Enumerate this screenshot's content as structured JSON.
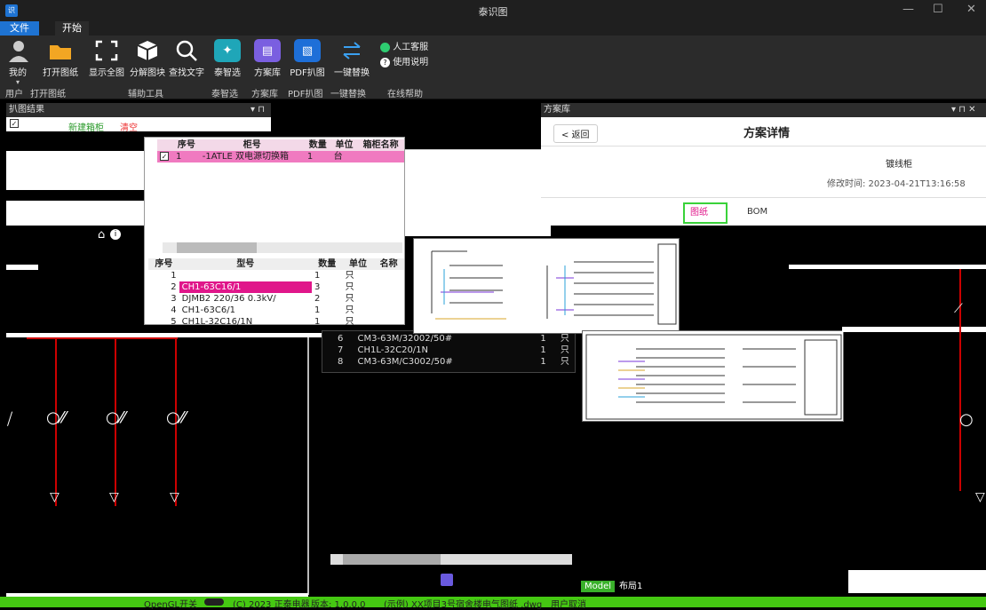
{
  "window": {
    "title": "泰识图",
    "min": "—",
    "max": "☐",
    "close": "✕"
  },
  "menu": {
    "file": "文件",
    "start": "开始"
  },
  "ribbon": {
    "buttons": {
      "me": "我的",
      "open": "打开图纸",
      "show_all": "显示全图",
      "explode": "分解图块",
      "find_text": "查找文字",
      "smart": "泰智选",
      "scheme_lib": "方案库",
      "pdf": "PDF扒图",
      "replace": "一键替换",
      "human": "人工客服",
      "help": "使用说明"
    },
    "groups": {
      "user": "用户",
      "open": "打开图纸",
      "aux": "辅助工具",
      "smart": "泰智选",
      "scheme_lib": "方案库",
      "pdf": "PDF扒图",
      "replace": "一键替换",
      "online": "在线帮助"
    }
  },
  "left_panel": {
    "title": "扒图结果",
    "pin": "▾ ⊓",
    "new_cabinet": "新建箱柜",
    "clear": "清空"
  },
  "cabinet_table": {
    "headers": [
      "序号",
      "柜号",
      "数量",
      "单位",
      "箱柜名称"
    ],
    "row": {
      "no": "1",
      "name": "-1ATLE 双电源切换箱",
      "qty": "1",
      "unit": "台"
    }
  },
  "parts_table": {
    "headers": [
      "序号",
      "型号",
      "数量",
      "单位",
      "名称"
    ],
    "rows": [
      {
        "no": "1",
        "model": "",
        "qty": "1",
        "unit": "只"
      },
      {
        "no": "2",
        "model": "CH1-63C16/1",
        "qty": "3",
        "unit": "只"
      },
      {
        "no": "3",
        "model": "DJMB2 220/36 0.3kV/",
        "qty": "2",
        "unit": "只"
      },
      {
        "no": "4",
        "model": "CH1-63C6/1",
        "qty": "1",
        "unit": "只"
      },
      {
        "no": "5",
        "model": "CH1L-32C16/1N",
        "qty": "1",
        "unit": "只"
      }
    ],
    "rows_lower": [
      {
        "no": "6",
        "model": "CM3-63M/32002/50#",
        "qty": "1",
        "unit": "只"
      },
      {
        "no": "7",
        "model": "CH1L-32C20/1N",
        "qty": "1",
        "unit": "只"
      },
      {
        "no": "8",
        "model": "CM3-63M/C3002/50#",
        "qty": "1",
        "unit": "只"
      }
    ]
  },
  "scheme_panel": {
    "title": "方案库",
    "pin": "▾ ⊓ ✕",
    "back": "< 返回",
    "detail_title": "方案详情",
    "name": "镀线柜",
    "modified": "修改时间: 2023-04-21T13:16:58",
    "tab_drawing": "图纸",
    "tab_bom": "BOM"
  },
  "layout_tabs": {
    "model": "Model",
    "layout": "布局1"
  },
  "statusbar": {
    "opengl": "OpenGL开关",
    "copyright": "(C) 2023 正泰电器",
    "version": "版本: 1.0.0.0",
    "file": "(示例) XX项目3号宿舍楼电气图纸 .dwg",
    "user": "用户取消"
  },
  "colors": {
    "accent": "#1e73d2",
    "status": "#45c812",
    "highlight": "#e0168a"
  }
}
